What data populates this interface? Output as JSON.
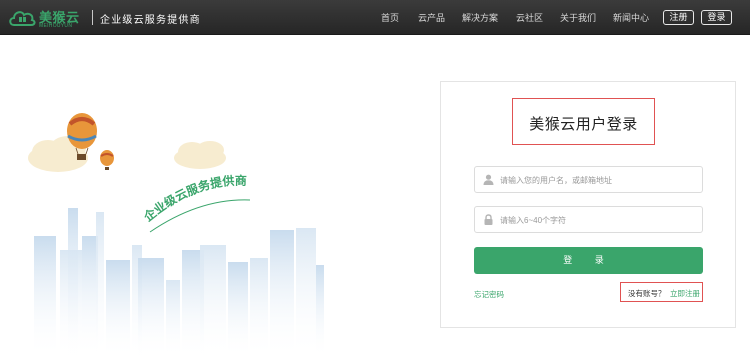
{
  "header": {
    "logo_text": "美猴云",
    "logo_sub": "MEIHOUYUN",
    "slogan": "企业级云服务提供商",
    "nav": [
      "首页",
      "云产品",
      "解决方案",
      "云社区",
      "关于我们",
      "新闻中心"
    ],
    "register_label": "注册",
    "login_label": "登录"
  },
  "illustration": {
    "banner_text": "企业级云服务提供商"
  },
  "login": {
    "title": "美猴云用户登录",
    "username_placeholder": "请输入您的用户名，或邮箱地址",
    "password_placeholder": "请输入6~40个字符",
    "submit_label": "登 录",
    "forgot_label": "忘记密码",
    "no_account_label": "没有账号？",
    "register_link_label": "立即注册"
  },
  "colors": {
    "brand_green": "#3aa56b",
    "header_bg": "#2e2e2e",
    "highlight_red": "#e05252"
  },
  "icons": {
    "user": "user-icon",
    "lock": "lock-icon"
  }
}
